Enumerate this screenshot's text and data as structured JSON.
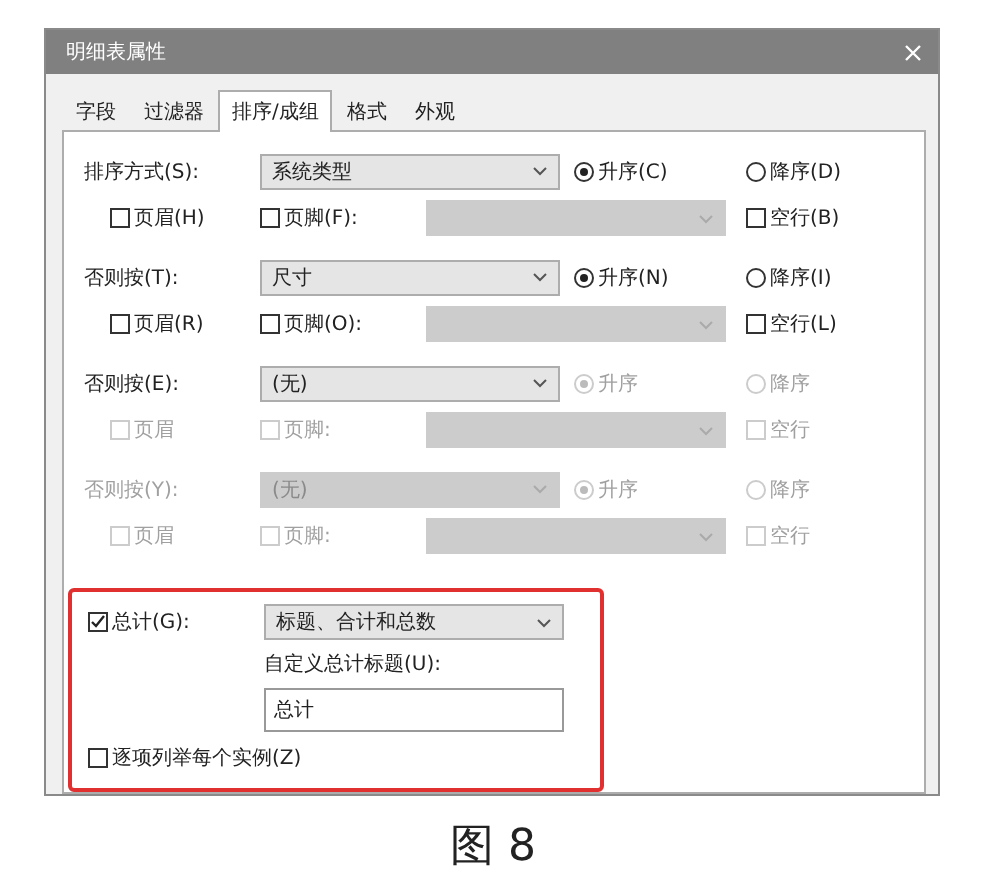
{
  "window": {
    "title": "明细表属性"
  },
  "tabs": [
    {
      "label": "字段",
      "selected": false
    },
    {
      "label": "过滤器",
      "selected": false
    },
    {
      "label": "排序/成组",
      "selected": true
    },
    {
      "label": "格式",
      "selected": false
    },
    {
      "label": "外观",
      "selected": false
    }
  ],
  "sort_groups": [
    {
      "label": "排序方式(S):",
      "disabled": false,
      "combo": {
        "value": "系统类型",
        "disabled": false
      },
      "ascending": {
        "label": "升序(C)",
        "selected": true,
        "disabled": false
      },
      "descending": {
        "label": "降序(D)",
        "selected": false,
        "disabled": false
      },
      "header": {
        "label": "页眉(H)",
        "checked": false,
        "disabled": false
      },
      "footer": {
        "label": "页脚(F):",
        "checked": false,
        "disabled": false
      },
      "footer_combo": {
        "disabled": true
      },
      "blank_line": {
        "label": "空行(B)",
        "checked": false,
        "disabled": false
      }
    },
    {
      "label": "否则按(T):",
      "disabled": false,
      "combo": {
        "value": "尺寸",
        "disabled": false
      },
      "ascending": {
        "label": "升序(N)",
        "selected": true,
        "disabled": false
      },
      "descending": {
        "label": "降序(I)",
        "selected": false,
        "disabled": false
      },
      "header": {
        "label": "页眉(R)",
        "checked": false,
        "disabled": false
      },
      "footer": {
        "label": "页脚(O):",
        "checked": false,
        "disabled": false
      },
      "footer_combo": {
        "disabled": true
      },
      "blank_line": {
        "label": "空行(L)",
        "checked": false,
        "disabled": false
      }
    },
    {
      "label": "否则按(E):",
      "disabled": false,
      "combo": {
        "value": "(无)",
        "disabled": false
      },
      "ascending": {
        "label": "升序",
        "selected": true,
        "disabled": true
      },
      "descending": {
        "label": "降序",
        "selected": false,
        "disabled": true
      },
      "header": {
        "label": "页眉",
        "checked": false,
        "disabled": true
      },
      "footer": {
        "label": "页脚:",
        "checked": false,
        "disabled": true
      },
      "footer_combo": {
        "disabled": true
      },
      "blank_line": {
        "label": "空行",
        "checked": false,
        "disabled": true
      }
    },
    {
      "label": "否则按(Y):",
      "disabled": true,
      "combo": {
        "value": "(无)",
        "disabled": true
      },
      "ascending": {
        "label": "升序",
        "selected": true,
        "disabled": true
      },
      "descending": {
        "label": "降序",
        "selected": false,
        "disabled": true
      },
      "header": {
        "label": "页眉",
        "checked": false,
        "disabled": true
      },
      "footer": {
        "label": "页脚:",
        "checked": false,
        "disabled": true
      },
      "footer_combo": {
        "disabled": true
      },
      "blank_line": {
        "label": "空行",
        "checked": false,
        "disabled": true
      }
    }
  ],
  "grand_total": {
    "checkbox": {
      "label": "总计(G):",
      "checked": true
    },
    "combo": {
      "value": "标题、合计和总数"
    },
    "custom_title_label": "自定义总计标题(U):",
    "custom_title": {
      "value": "总计"
    },
    "itemize": {
      "label": "逐项列举每个实例(Z)",
      "checked": false
    }
  },
  "caption": "图 8"
}
